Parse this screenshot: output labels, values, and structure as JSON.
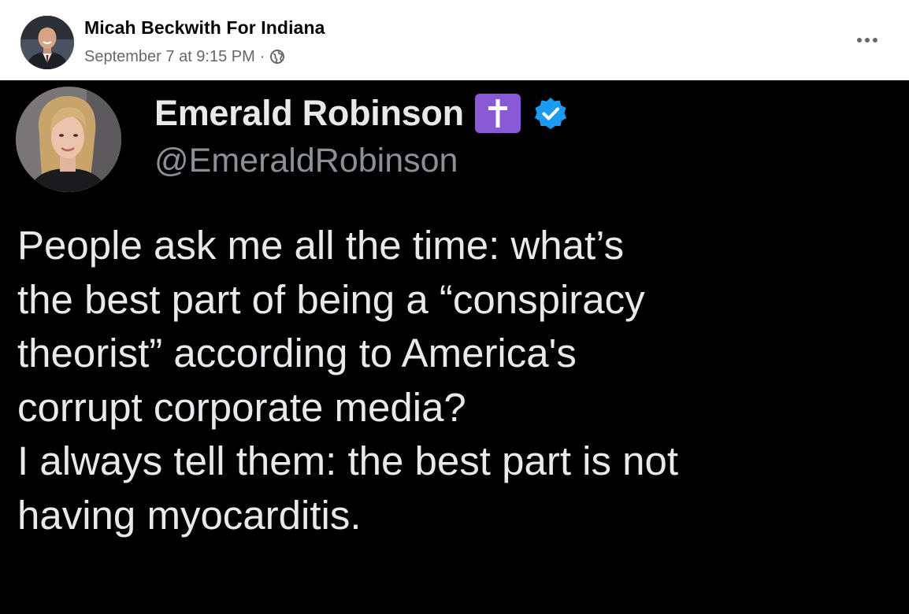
{
  "post": {
    "author_name": "Micah Beckwith For Indiana",
    "timestamp": "September 7 at 9:15 PM",
    "separator": "·",
    "privacy_icon": "globe-icon",
    "more_icon": "more-options-icon"
  },
  "tweet": {
    "display_name": "Emerald Robinson",
    "handle": "@EmeraldRobinson",
    "badge_glyph": "✝",
    "badge_color": "#8a5ad6",
    "verified_color": "#1d9bf0",
    "text_lines": [
      "People ask me all the time: what’s",
      "the best part of being a “conspiracy",
      "theorist” according to America's",
      "corrupt corporate media?",
      "I always tell them: the best part is not",
      "having myocarditis."
    ]
  }
}
